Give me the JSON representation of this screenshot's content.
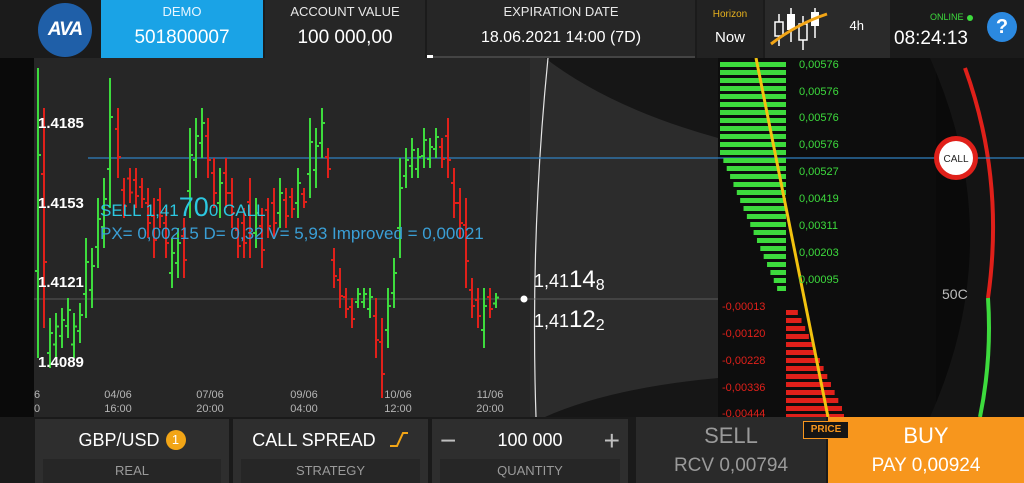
{
  "header": {
    "logo": "AVA",
    "demo_label": "DEMO",
    "account_id": "501800007",
    "account_value_label": "ACCOUNT VALUE",
    "account_value": "100 000,00",
    "expiration_label": "EXPIRATION DATE",
    "expiration_value": "18.06.2021 14:00 (7D)",
    "horizon_label": "Horizon",
    "horizon_value": "Now",
    "timeframe": "4h",
    "status": "ONLINE",
    "time": "08:24:13",
    "help": "?"
  },
  "chart": {
    "price_labels": [
      "1.4185",
      "1.4153",
      "1.4121",
      "1.4089"
    ],
    "time_labels": [
      {
        "date": "04/06",
        "time": "16:00"
      },
      {
        "date": "07/06",
        "time": "20:00"
      },
      {
        "date": "09/06",
        "time": "04:00"
      },
      {
        "date": "10/06",
        "time": "12:00"
      },
      {
        "date": "11/06",
        "time": "20:00"
      }
    ],
    "edge_labels": [
      "6",
      "0"
    ],
    "sell_line": {
      "pre": "SELL  1,41",
      "big": "70",
      "post": "0  CALL"
    },
    "order_info": "PX= 0,00215 D= 0,32 V= 5,93 Improved = 0,00021",
    "ask": {
      "pre": "1,41",
      "big": "14",
      "sub": "8"
    },
    "bid": {
      "pre": "1,41",
      "big": "12",
      "sub": "2"
    },
    "profit_labels": [
      "0,00576",
      "0,00576",
      "0,00576",
      "0,00576",
      "0,00527",
      "0,00419",
      "0,00311",
      "0,00203",
      "0,00095"
    ],
    "loss_labels": [
      "-0,00013",
      "-0,00120",
      "-0,00228",
      "-0,00336",
      "-0,00444"
    ],
    "call_button": "CALL",
    "strike_label": "50C",
    "colors": {
      "up": "#3ddb3d",
      "down": "#e0201a",
      "sell_line": "#2cc7e0",
      "accent": "#f7961d"
    }
  },
  "footer": {
    "asset": "GBP/USD",
    "asset_badge": "1",
    "asset_sub": "REAL",
    "strategy": "CALL SPREAD",
    "strategy_sub": "STRATEGY",
    "quantity": "100 000",
    "quantity_sub": "QUANTITY",
    "minus": "−",
    "plus": "+",
    "sell_label": "SELL",
    "sell_value": "RCV 0,00794",
    "price_badge": "PRICE",
    "buy_label": "BUY",
    "buy_value": "PAY 0,00924"
  }
}
